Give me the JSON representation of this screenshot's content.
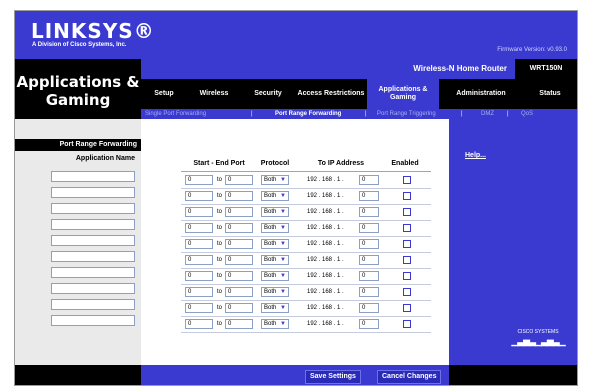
{
  "brand": {
    "logo": "LINKSYS®",
    "subtitle": "A Division of Cisco Systems, Inc.",
    "firmware": "Firmware Version: v0.93.0"
  },
  "page_title": "Applications & Gaming",
  "product": {
    "name": "Wireless-N Home Router",
    "model": "WRT150N"
  },
  "tabs": [
    {
      "label": "Setup"
    },
    {
      "label": "Wireless"
    },
    {
      "label": "Security"
    },
    {
      "label": "Access Restrictions"
    },
    {
      "label": "Applications & Gaming"
    },
    {
      "label": "Administration"
    },
    {
      "label": "Status"
    }
  ],
  "subtabs": [
    {
      "label": "Single Port Forwarding"
    },
    {
      "label": "Port Range Forwarding"
    },
    {
      "label": "Port Range Triggering"
    },
    {
      "label": "DMZ"
    },
    {
      "label": "QoS"
    }
  ],
  "section_title": "Port Range Forwarding",
  "columns": {
    "app_name": "Application Name",
    "start_end": "Start - End Port",
    "protocol": "Protocol",
    "ip": "To IP Address",
    "enabled": "Enabled"
  },
  "rows": [
    {
      "start": "0",
      "to": "to",
      "end": "0",
      "protocol": "Both",
      "ip_prefix": "192 . 168 . 1 .",
      "ip_last": "0"
    },
    {
      "start": "0",
      "to": "to",
      "end": "0",
      "protocol": "Both",
      "ip_prefix": "192 . 168 . 1 .",
      "ip_last": "0"
    },
    {
      "start": "0",
      "to": "to",
      "end": "0",
      "protocol": "Both",
      "ip_prefix": "192 . 168 . 1 .",
      "ip_last": "0"
    },
    {
      "start": "0",
      "to": "to",
      "end": "0",
      "protocol": "Both",
      "ip_prefix": "192 . 168 . 1 .",
      "ip_last": "0"
    },
    {
      "start": "0",
      "to": "to",
      "end": "0",
      "protocol": "Both",
      "ip_prefix": "192 . 168 . 1 .",
      "ip_last": "0"
    },
    {
      "start": "0",
      "to": "to",
      "end": "0",
      "protocol": "Both",
      "ip_prefix": "192 . 168 . 1 .",
      "ip_last": "0"
    },
    {
      "start": "0",
      "to": "to",
      "end": "0",
      "protocol": "Both",
      "ip_prefix": "192 . 168 . 1 .",
      "ip_last": "0"
    },
    {
      "start": "0",
      "to": "to",
      "end": "0",
      "protocol": "Both",
      "ip_prefix": "192 . 168 . 1 .",
      "ip_last": "0"
    },
    {
      "start": "0",
      "to": "to",
      "end": "0",
      "protocol": "Both",
      "ip_prefix": "192 . 168 . 1 .",
      "ip_last": "0"
    },
    {
      "start": "0",
      "to": "to",
      "end": "0",
      "protocol": "Both",
      "ip_prefix": "192 . 168 . 1 .",
      "ip_last": "0"
    }
  ],
  "help_link": "Help...",
  "cisco_label": "CISCO SYSTEMS",
  "buttons": {
    "save": "Save Settings",
    "cancel": "Cancel Changes"
  },
  "colors": {
    "brand_blue": "#3a3ad0",
    "black": "#000000"
  }
}
